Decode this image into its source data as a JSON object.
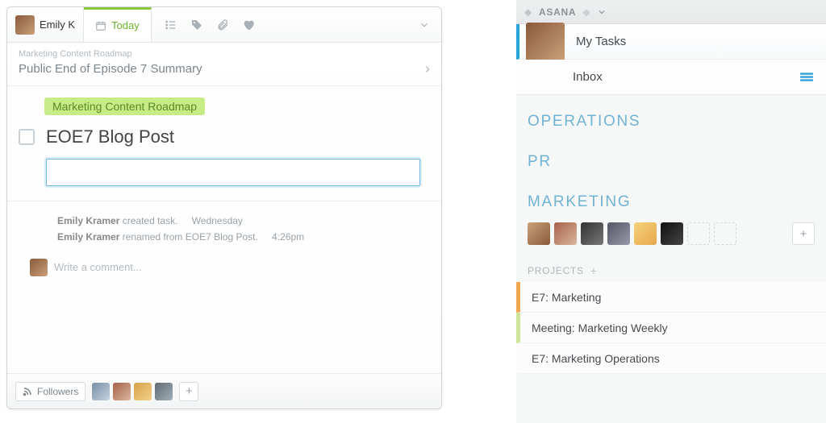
{
  "left": {
    "user_name": "Emily K",
    "tab_today": "Today",
    "breadcrumb_project": "Marketing Content Roadmap",
    "breadcrumb_title": "Public End of Episode 7 Summary",
    "project_pill": "Marketing Content Roadmap",
    "task_name": "EOE7 Blog Post",
    "description_value": "",
    "description_placeholder": "",
    "activity": [
      {
        "actor": "Emily Kramer",
        "verb": "created task.",
        "time": "Wednesday"
      },
      {
        "actor": "Emily Kramer",
        "verb": "renamed from EOE7 Blog Post.",
        "time": "4:26pm"
      }
    ],
    "comment_placeholder": "Write a comment...",
    "followers_label": "Followers",
    "follower_count": 4
  },
  "right": {
    "workspace": "ASANA",
    "nav": {
      "my_tasks": "My Tasks",
      "inbox": "Inbox"
    },
    "teams": [
      {
        "name": "OPERATIONS"
      },
      {
        "name": "PR"
      },
      {
        "name": "MARKETING"
      }
    ],
    "marketing_avatar_count": 6,
    "section_label": "PROJECTS",
    "projects": [
      {
        "name": "E7: Marketing",
        "color": "orange"
      },
      {
        "name": "Meeting: Marketing Weekly",
        "color": "green"
      },
      {
        "name": "E7: Marketing Operations",
        "color": "none"
      }
    ]
  }
}
